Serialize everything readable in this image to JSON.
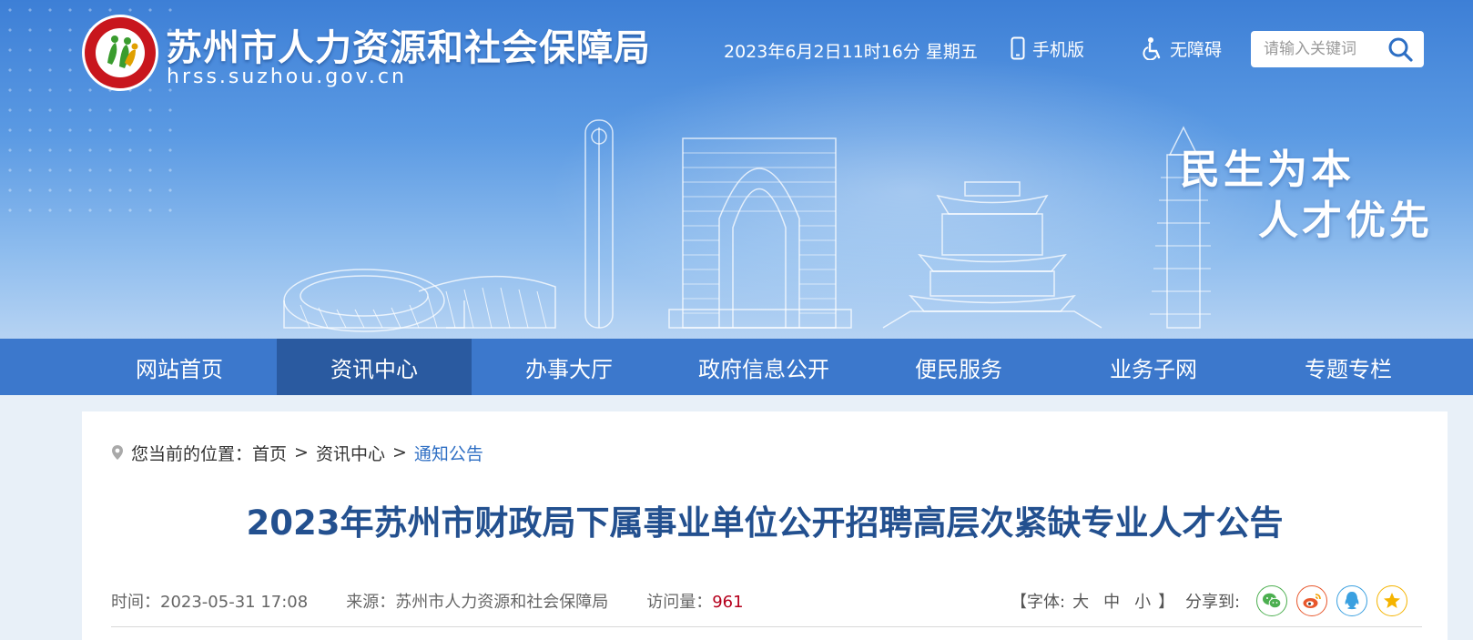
{
  "header": {
    "site_title": "苏州市人力资源和社会保障局",
    "site_url": "hrss.suzhou.gov.cn",
    "datetime": "2023年6月2日11时16分 星期五",
    "mobile_label": "手机版",
    "accessibility_label": "无障碍",
    "search": {
      "placeholder": "请输入关键词"
    },
    "slogan_line1": "民生为本",
    "slogan_line2": "人才优先"
  },
  "nav": {
    "items": [
      {
        "label": "网站首页"
      },
      {
        "label": "资讯中心"
      },
      {
        "label": "办事大厅"
      },
      {
        "label": "政府信息公开"
      },
      {
        "label": "便民服务"
      },
      {
        "label": "业务子网"
      },
      {
        "label": "专题专栏"
      }
    ],
    "active_index": 1
  },
  "breadcrumb": {
    "prefix": "您当前的位置：",
    "items": [
      "首页",
      "资讯中心",
      "通知公告"
    ],
    "separator": ">"
  },
  "article": {
    "title": "2023年苏州市财政局下属事业单位公开招聘高层次紧缺专业人才公告",
    "time_label": "时间：",
    "time_value": "2023-05-31 17:08",
    "source_label": "来源：",
    "source_value": "苏州市人力资源和社会保障局",
    "views_label": "访问量：",
    "views_value": "961"
  },
  "font_control": {
    "open": "【字体:",
    "large": "大",
    "medium": "中",
    "small": "小",
    "close": "】"
  },
  "share": {
    "label": "分享到:",
    "targets": [
      "wechat-icon",
      "weibo-icon",
      "qq-icon",
      "qzone-icon"
    ]
  },
  "colors": {
    "nav_bg": "#3c78cc",
    "nav_active": "#2a5aa0",
    "title": "#23508f",
    "link_current": "#2f6fc4",
    "views_count": "#b5001c",
    "wechat": "#4caf50",
    "weibo": "#e8572c",
    "qq": "#3aa0e0",
    "qzone": "#f5b400"
  }
}
